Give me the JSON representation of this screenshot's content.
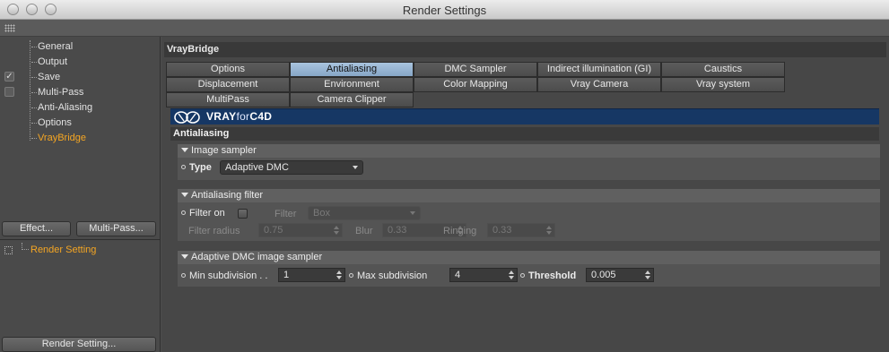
{
  "window": {
    "title": "Render Settings"
  },
  "sidebar": {
    "items": [
      {
        "label": "General",
        "checkbox": null
      },
      {
        "label": "Output",
        "checkbox": null
      },
      {
        "label": "Save",
        "checkbox": "checked"
      },
      {
        "label": "Multi-Pass",
        "checkbox": "unchecked"
      },
      {
        "label": "Anti-Aliasing",
        "checkbox": null
      },
      {
        "label": "Options",
        "checkbox": null
      },
      {
        "label": "VrayBridge",
        "checkbox": null,
        "active": true
      }
    ],
    "effect_button": "Effect...",
    "multipass_button": "Multi-Pass...",
    "render_setting_item": "Render Setting",
    "render_setting_button": "Render Setting..."
  },
  "main": {
    "header": "VrayBridge",
    "tabs": [
      "Options",
      "Antialiasing",
      "DMC Sampler",
      "Indirect illumination (GI)",
      "Caustics",
      "Displacement",
      "Environment",
      "Color Mapping",
      "Vray Camera",
      "Vray system",
      "MultiPass",
      "Camera Clipper"
    ],
    "active_tab": "Antialiasing",
    "banner": {
      "brand": "VRAY",
      "for": "for",
      "product": "C4D"
    },
    "section_title": "Antialiasing",
    "image_sampler": {
      "title": "Image sampler",
      "type_label": "Type",
      "type_value": "Adaptive DMC"
    },
    "aa_filter": {
      "title": "Antialiasing filter",
      "filter_on_label": "Filter on",
      "filter_label": "Filter",
      "filter_value": "Box",
      "radius_label": "Filter radius",
      "radius_value": "0.75",
      "blur_label": "Blur",
      "blur_value": "0.33",
      "ringing_label": "Ringing",
      "ringing_value": "0.33"
    },
    "adaptive_dmc": {
      "title": "Adaptive DMC image sampler",
      "min_label": "Min subdivision . .",
      "min_value": "1",
      "max_label": "Max subdivision",
      "max_value": "4",
      "threshold_label": "Threshold",
      "threshold_value": "0.005"
    }
  },
  "colors": {
    "accent_active": "#f5a623",
    "tab_active": "#9ab8d6",
    "banner": "#163764"
  }
}
